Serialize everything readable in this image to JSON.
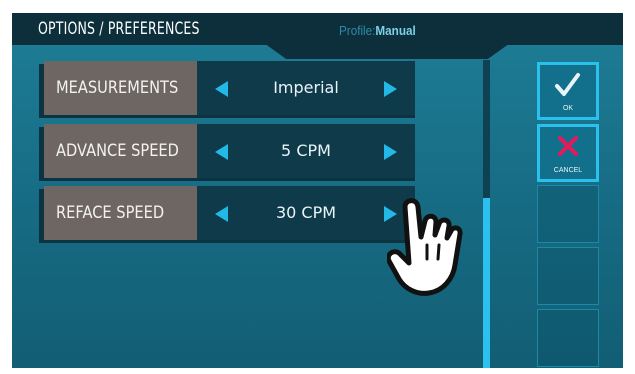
{
  "header": {
    "title": "OPTIONS / PREFERENCES",
    "profile_label": "Profile:",
    "profile_value": "Manual"
  },
  "settings": [
    {
      "label": "MEASUREMENTS",
      "value": "Imperial"
    },
    {
      "label": "ADVANCE SPEED",
      "value": "5 CPM"
    },
    {
      "label": "REFACE SPEED",
      "value": "30 CPM"
    }
  ],
  "actions": {
    "ok_label": "OK",
    "cancel_label": "CANCEL"
  },
  "colors": {
    "accent": "#2cc0ef",
    "cancel": "#e8195a",
    "background": "#1a7590",
    "panel": "#0f3a4a",
    "label_bg": "#6e6663"
  },
  "icons": {
    "ok": "check-icon",
    "cancel": "x-icon",
    "pointer": "hand-pointer-icon"
  },
  "scrollbar": {
    "position_fraction": 0.45
  }
}
